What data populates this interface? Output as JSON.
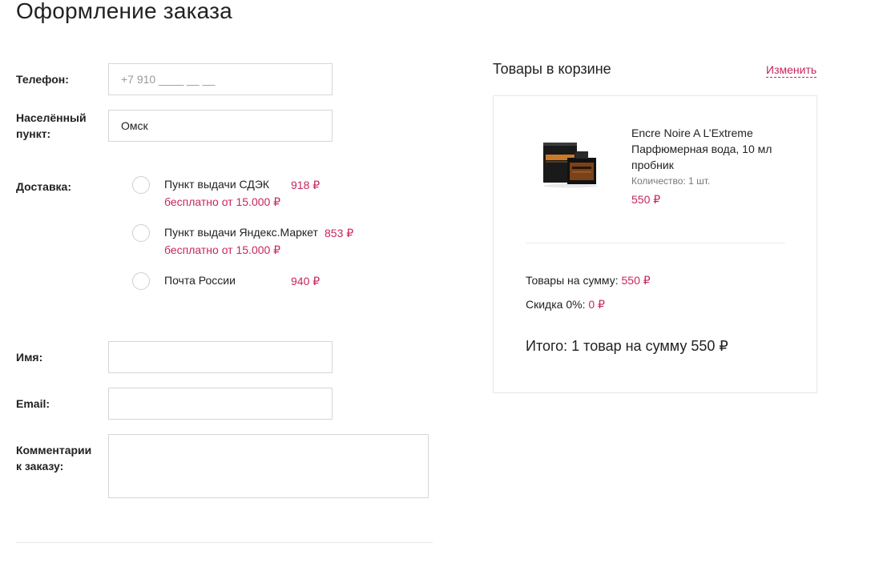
{
  "page": {
    "title": "Оформление заказа"
  },
  "form": {
    "phone": {
      "label": "Телефон:",
      "value": "",
      "placeholder": "+7 910 ____ __ __"
    },
    "city": {
      "label": "Населённый пункт:",
      "value": "Омск",
      "placeholder": ""
    },
    "delivery": {
      "label": "Доставка:",
      "options": [
        {
          "name": "Пункт выдачи СДЭК",
          "price": "918 ₽",
          "note": "бесплатно от 15.000 ₽",
          "selected": false
        },
        {
          "name": "Пункт выдачи Яндекс.Маркет",
          "price": "853 ₽",
          "note": "бесплатно от 15.000 ₽",
          "selected": false
        },
        {
          "name": "Почта России",
          "price": "940 ₽",
          "note": "",
          "selected": false
        }
      ]
    },
    "name": {
      "label": "Имя:",
      "value": ""
    },
    "email": {
      "label": "Email:",
      "value": ""
    },
    "comment": {
      "label": "Комментарии к заказу:",
      "value": ""
    }
  },
  "cart": {
    "title": "Товары в корзине",
    "edit_label": "Изменить",
    "items": [
      {
        "name": "Encre Noire A L’Extreme Парфюмерная вода, 10 мл пробник",
        "quantity": "Количество: 1 шт.",
        "price": "550 ₽"
      }
    ],
    "subtotal_label": "Товары на сумму:",
    "subtotal_value": "550 ₽",
    "discount_label": "Скидка 0%:",
    "discount_value": "0 ₽",
    "total": "Итого: 1 товар на сумму 550 ₽"
  },
  "colors": {
    "accent": "#c8265a",
    "border": "#d6d6d6",
    "text": "#222222"
  }
}
